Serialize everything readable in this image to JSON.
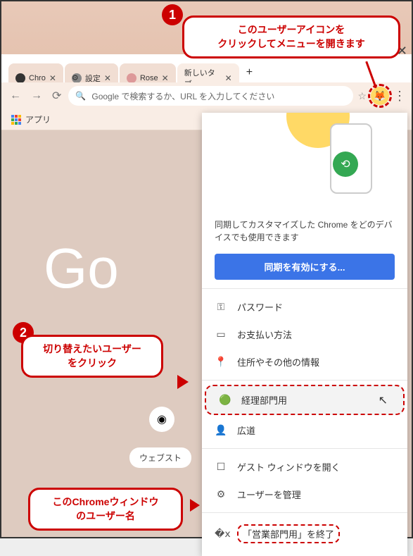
{
  "tabs": [
    {
      "label": "Chro",
      "favicon_color": "#555"
    },
    {
      "label": "設定",
      "favicon_color": "#888"
    },
    {
      "label": "Rose",
      "favicon_color": "#d66"
    },
    {
      "label": "新しいタブ",
      "favicon_color": "transparent",
      "active": true
    }
  ],
  "omnibox": {
    "placeholder": "Google で検索するか、URL を入力してください"
  },
  "bookmarks": {
    "apps_label": "アプリ"
  },
  "content": {
    "logo_text": "Go",
    "webstore": "ウェブスト"
  },
  "profile_menu": {
    "desc": "同期してカスタマイズした Chrome をどのデバイスでも使用できます",
    "sync_btn": "同期を有効にする...",
    "items_main": [
      {
        "icon": "⚿",
        "label": "パスワード"
      },
      {
        "icon": "▭",
        "label": "お支払い方法"
      },
      {
        "icon": "📍",
        "label": "住所やその他の情報"
      }
    ],
    "profiles": [
      {
        "label": "経理部門用",
        "highlighted": true
      },
      {
        "label": "広道"
      }
    ],
    "items_bottom": [
      {
        "icon": "☐",
        "label": "ゲスト ウィンドウを開く"
      },
      {
        "icon": "⚙",
        "label": "ユーザーを管理"
      }
    ],
    "exit_label": "「営業部門用」を終了"
  },
  "callouts": {
    "c1": "このユーザーアイコンを\nクリックしてメニューを開きます",
    "c2": "切り替えたいユーザー\nをクリック",
    "c3": "このChromeウィンドウ\nのユーザー名",
    "badge1": "1",
    "badge2": "2"
  }
}
